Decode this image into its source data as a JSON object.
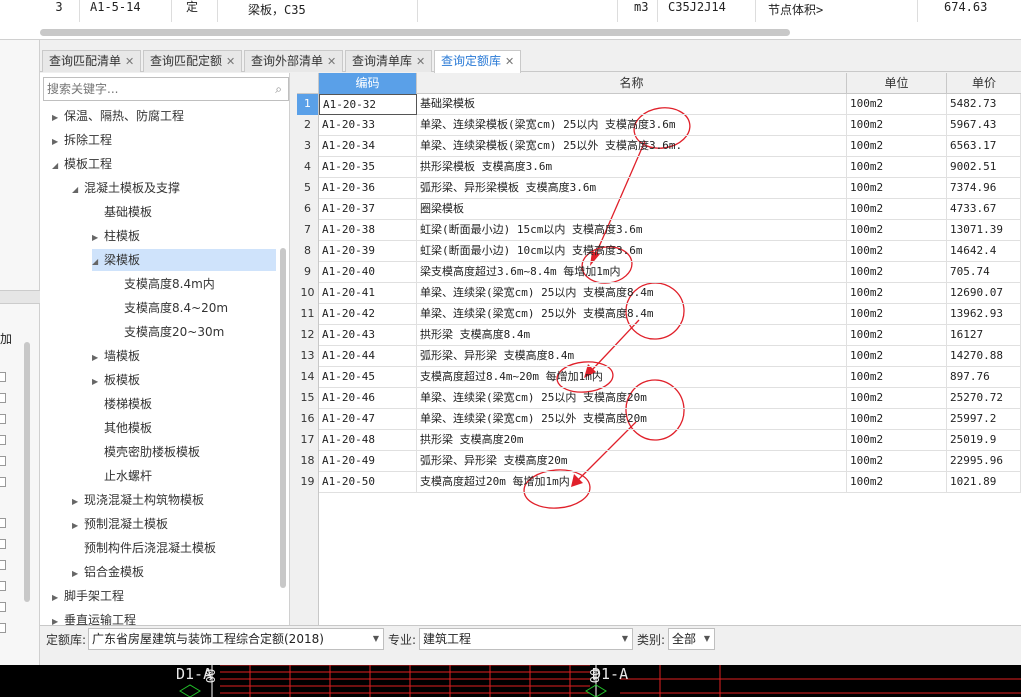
{
  "top_row": {
    "index": "3",
    "code": "A1-5-14",
    "flag": "定",
    "name": "梁板，C35",
    "unit": "m3",
    "material": "C35J2J14",
    "rule": "节点体积>",
    "amount": "674.63"
  },
  "tabs": [
    {
      "label": "查询匹配清单",
      "active": false
    },
    {
      "label": "查询匹配定额",
      "active": false
    },
    {
      "label": "查询外部清单",
      "active": false
    },
    {
      "label": "查询清单库",
      "active": false
    },
    {
      "label": "查询定额库",
      "active": true
    }
  ],
  "search": {
    "placeholder": "搜索关键字..."
  },
  "tree": [
    {
      "label": "保温、隔热、防腐工程",
      "arrow": "right"
    },
    {
      "label": "拆除工程",
      "arrow": "right"
    },
    {
      "label": "模板工程",
      "arrow": "down"
    },
    {
      "label": "混凝土模板及支撑",
      "arrow": "down"
    },
    {
      "label": "基础模板",
      "arrow": ""
    },
    {
      "label": "柱模板",
      "arrow": "right"
    },
    {
      "label": "梁模板",
      "arrow": "down"
    },
    {
      "label": "支模高度8.4m内",
      "arrow": ""
    },
    {
      "label": "支模高度8.4~20m",
      "arrow": ""
    },
    {
      "label": "支模高度20~30m",
      "arrow": ""
    },
    {
      "label": "墙模板",
      "arrow": "right"
    },
    {
      "label": "板模板",
      "arrow": "right"
    },
    {
      "label": "楼梯模板",
      "arrow": ""
    },
    {
      "label": "其他模板",
      "arrow": ""
    },
    {
      "label": "模壳密肋楼板模板",
      "arrow": ""
    },
    {
      "label": "止水螺杆",
      "arrow": ""
    },
    {
      "label": "现浇混凝土构筑物模板",
      "arrow": "right"
    },
    {
      "label": "预制混凝土模板",
      "arrow": "right"
    },
    {
      "label": "预制构件后浇混凝土模板",
      "arrow": ""
    },
    {
      "label": "铝合金模板",
      "arrow": "right"
    },
    {
      "label": "脚手架工程",
      "arrow": "right"
    },
    {
      "label": "垂直运输工程",
      "arrow": "right"
    }
  ],
  "grid": {
    "columns": [
      "编码",
      "名称",
      "单位",
      "单价"
    ],
    "rows": [
      {
        "n": "1",
        "code": "A1-20-32",
        "name": "基础梁模板",
        "unit": "100m2",
        "price": "5482.73"
      },
      {
        "n": "2",
        "code": "A1-20-33",
        "name": "单梁、连续梁模板(梁宽cm) 25以内 支模高度3.6m",
        "unit": "100m2",
        "price": "5967.43"
      },
      {
        "n": "3",
        "code": "A1-20-34",
        "name": "单梁、连续梁模板(梁宽cm) 25以外 支模高度3.6m.",
        "unit": "100m2",
        "price": "6563.17"
      },
      {
        "n": "4",
        "code": "A1-20-35",
        "name": "拱形梁模板 支模高度3.6m",
        "unit": "100m2",
        "price": "9002.51"
      },
      {
        "n": "5",
        "code": "A1-20-36",
        "name": "弧形梁、异形梁模板 支模高度3.6m",
        "unit": "100m2",
        "price": "7374.96"
      },
      {
        "n": "6",
        "code": "A1-20-37",
        "name": "圈梁模板",
        "unit": "100m2",
        "price": "4733.67"
      },
      {
        "n": "7",
        "code": "A1-20-38",
        "name": "虹梁(断面最小边) 15cm以内 支模高度3.6m",
        "unit": "100m2",
        "price": "13071.39"
      },
      {
        "n": "8",
        "code": "A1-20-39",
        "name": "虹梁(断面最小边) 10cm以内 支模高度3.6m",
        "unit": "100m2",
        "price": "14642.4"
      },
      {
        "n": "9",
        "code": "A1-20-40",
        "name": "梁支模高度超过3.6m~8.4m 每增加1m内",
        "unit": "100m2",
        "price": "705.74"
      },
      {
        "n": "10",
        "code": "A1-20-41",
        "name": "单梁、连续梁(梁宽cm) 25以内 支模高度8.4m",
        "unit": "100m2",
        "price": "12690.07"
      },
      {
        "n": "11",
        "code": "A1-20-42",
        "name": "单梁、连续梁(梁宽cm) 25以外 支模高度8.4m",
        "unit": "100m2",
        "price": "13962.93"
      },
      {
        "n": "12",
        "code": "A1-20-43",
        "name": "拱形梁 支模高度8.4m",
        "unit": "100m2",
        "price": "16127"
      },
      {
        "n": "13",
        "code": "A1-20-44",
        "name": "弧形梁、异形梁 支模高度8.4m",
        "unit": "100m2",
        "price": "14270.88"
      },
      {
        "n": "14",
        "code": "A1-20-45",
        "name": "支模高度超过8.4m~20m 每增加1m内",
        "unit": "100m2",
        "price": "897.76"
      },
      {
        "n": "15",
        "code": "A1-20-46",
        "name": "单梁、连续梁(梁宽cm) 25以内 支模高度20m",
        "unit": "100m2",
        "price": "25270.72"
      },
      {
        "n": "16",
        "code": "A1-20-47",
        "name": "单梁、连续梁(梁宽cm) 25以外 支模高度20m",
        "unit": "100m2",
        "price": "25997.2"
      },
      {
        "n": "17",
        "code": "A1-20-48",
        "name": "拱形梁 支模高度20m",
        "unit": "100m2",
        "price": "25019.9"
      },
      {
        "n": "18",
        "code": "A1-20-49",
        "name": "弧形梁、异形梁 支模高度20m",
        "unit": "100m2",
        "price": "22995.96"
      },
      {
        "n": "19",
        "code": "A1-20-50",
        "name": "支模高度超过20m 每增加1m内",
        "unit": "100m2",
        "price": "1021.89"
      }
    ]
  },
  "filters": {
    "library_label": "定额库:",
    "library_value": "广东省房屋建筑与装饰工程综合定额(2018)",
    "major_label": "专业:",
    "major_value": "建筑工程",
    "category_label": "类别:",
    "category_value": "全部"
  },
  "left_outer": {
    "label": "加"
  },
  "cad": {
    "label_left": "D1-A",
    "label_right": "D1-A",
    "tick_text": "00"
  },
  "colors": {
    "accent": "#5aa0e8",
    "annotation": "#e0202a",
    "tab_active": "#2a7ad6",
    "selected": "#cfe3fb"
  }
}
